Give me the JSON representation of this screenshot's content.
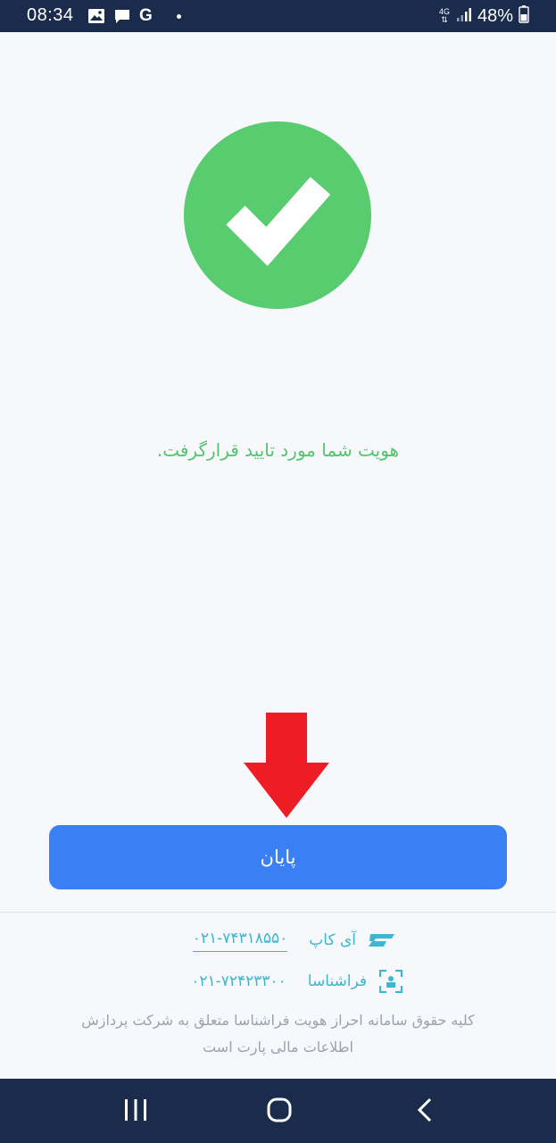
{
  "status_bar": {
    "time": "08:34",
    "network_label": "4G",
    "battery": "48%",
    "google_letter": "G",
    "left_icons": [
      "image-icon",
      "chat-icon",
      "google-icon",
      "notification-dot"
    ],
    "right_icons": [
      "network-4g-icon",
      "signal-icon",
      "battery-icon"
    ]
  },
  "success": {
    "icon": "checkmark-icon",
    "color": "#58cc6e",
    "message": "هویت شما مورد تایید قرارگرفت."
  },
  "annotation": {
    "icon": "red-arrow-icon",
    "color": "#ee1c24"
  },
  "actions": {
    "finish_label": "پایان",
    "button_color": "#3b7ff5"
  },
  "footer": {
    "contacts": [
      {
        "name": "آی کاپ",
        "phone": "۰۲۱-۷۴۳۱۸۵۵۰",
        "icon": "icup-logo-icon"
      },
      {
        "name": "فراشناسا",
        "phone": "۰۲۱-۷۲۴۲۳۳۰۰",
        "icon": "farashenasa-logo-icon"
      }
    ],
    "copyright_line1": "کلیه حقوق سامانه احراز هویت فراشناسا متعلق به شرکت پردازش",
    "copyright_line2": "اطلاعات مالی پارت است"
  },
  "nav_bar": {
    "buttons": [
      "recent-apps-icon",
      "home-icon",
      "back-icon"
    ]
  }
}
